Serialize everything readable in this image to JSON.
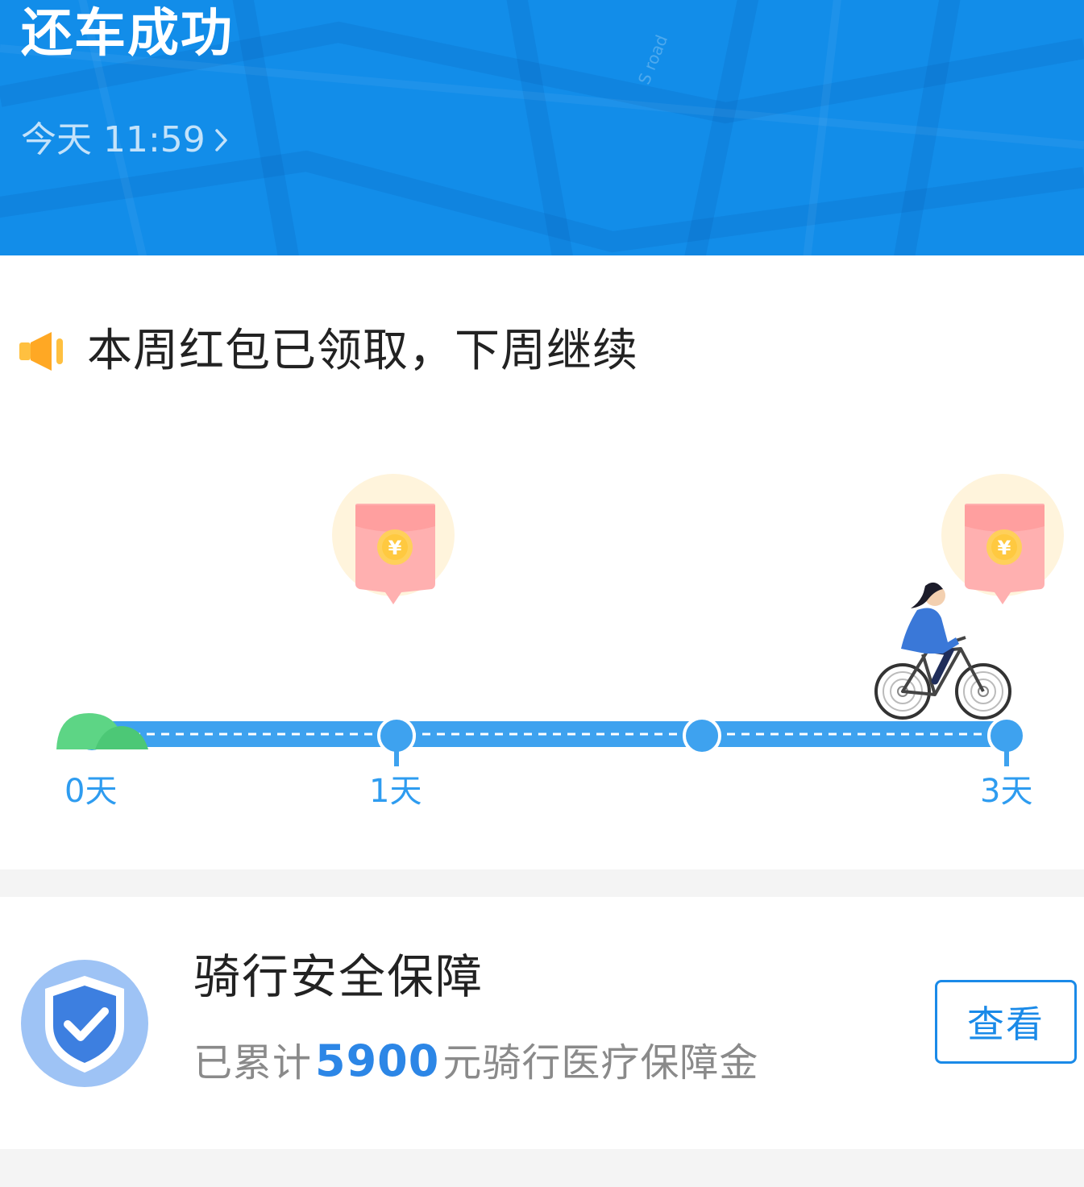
{
  "header": {
    "title": "还车成功",
    "time": "今天 11:59",
    "map_label": "S road"
  },
  "notice": {
    "text": "本周红包已领取，下周继续",
    "icon": "speaker-icon"
  },
  "progress": {
    "labels": [
      "0天",
      "1天",
      "3天"
    ],
    "current_day": 3,
    "icons": [
      "red-envelope-icon",
      "cyclist-icon",
      "hill-icon"
    ]
  },
  "insurance": {
    "title": "骑行安全保障",
    "subtitle_prefix": "已累计",
    "amount": "5900",
    "subtitle_suffix": "元骑行医疗保障金",
    "button_label": "查看",
    "icon": "shield-check-icon"
  },
  "colors": {
    "header_bg": "#128de9",
    "accent": "#2e9cf0",
    "amount": "#2c86e6",
    "hill": "#5dd585"
  }
}
